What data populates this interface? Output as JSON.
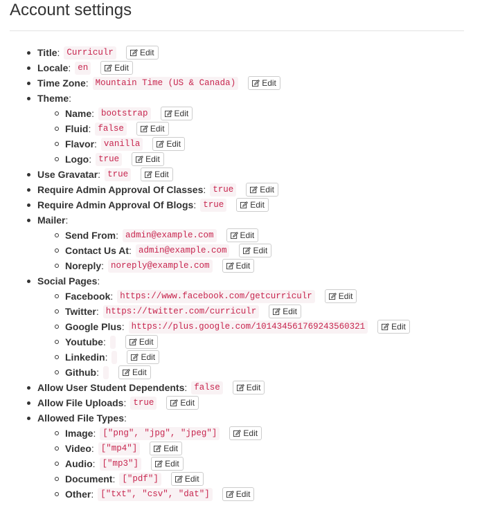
{
  "page_title": "Account settings",
  "edit_label": "Edit",
  "settings": [
    {
      "key": "Title",
      "value": "Curriculr"
    },
    {
      "key": "Locale",
      "value": "en"
    },
    {
      "key": "Time Zone",
      "value": "Mountain Time (US & Canada)"
    },
    {
      "key": "Theme",
      "children": [
        {
          "key": "Name",
          "value": "bootstrap"
        },
        {
          "key": "Fluid",
          "value": "false"
        },
        {
          "key": "Flavor",
          "value": "vanilla"
        },
        {
          "key": "Logo",
          "value": "true"
        }
      ]
    },
    {
      "key": "Use Gravatar",
      "value": "true"
    },
    {
      "key": "Require Admin Approval Of Classes",
      "value": "true"
    },
    {
      "key": "Require Admin Approval Of Blogs",
      "value": "true"
    },
    {
      "key": "Mailer",
      "children": [
        {
          "key": "Send From",
          "value": "admin@example.com"
        },
        {
          "key": "Contact Us At",
          "value": "admin@example.com"
        },
        {
          "key": "Noreply",
          "value": "noreply@example.com"
        }
      ]
    },
    {
      "key": "Social Pages",
      "children": [
        {
          "key": "Facebook",
          "value": "https://www.facebook.com/getcurriculr"
        },
        {
          "key": "Twitter",
          "value": "https://twitter.com/curriculr"
        },
        {
          "key": "Google Plus",
          "value": "https://plus.google.com/101434561769243560321"
        },
        {
          "key": "Youtube",
          "value": ""
        },
        {
          "key": "Linkedin",
          "value": ""
        },
        {
          "key": "Github",
          "value": ""
        }
      ]
    },
    {
      "key": "Allow User Student Dependents",
      "value": "false"
    },
    {
      "key": "Allow File Uploads",
      "value": "true"
    },
    {
      "key": "Allowed File Types",
      "children": [
        {
          "key": "Image",
          "value": "[\"png\", \"jpg\", \"jpeg\"]"
        },
        {
          "key": "Video",
          "value": "[\"mp4\"]"
        },
        {
          "key": "Audio",
          "value": "[\"mp3\"]"
        },
        {
          "key": "Document",
          "value": "[\"pdf\"]"
        },
        {
          "key": "Other",
          "value": "[\"txt\", \"csv\", \"dat\"]"
        }
      ]
    }
  ]
}
